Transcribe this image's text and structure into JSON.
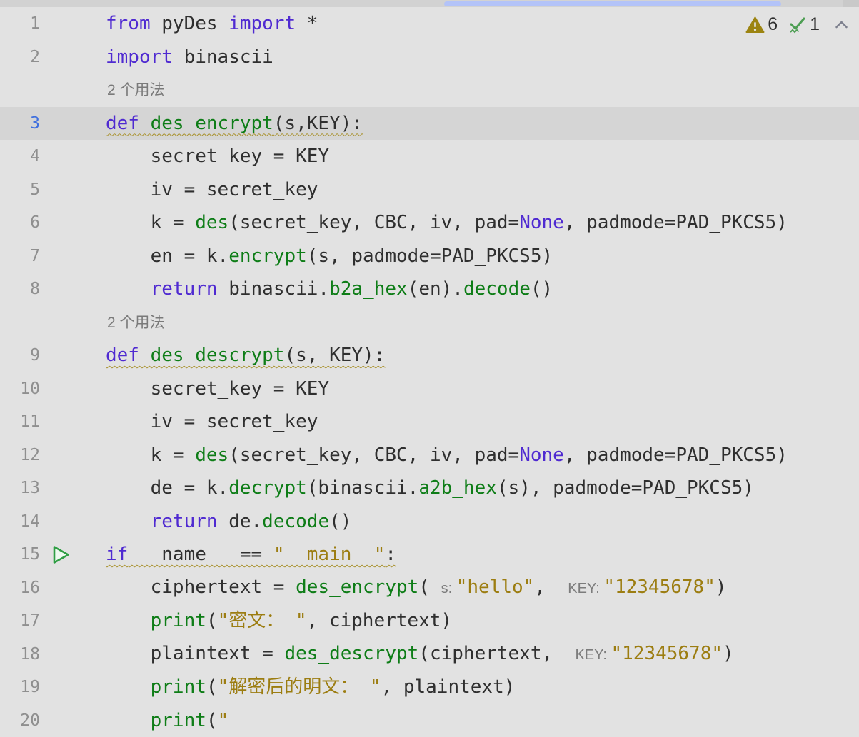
{
  "colors": {
    "editor_bg": "#e2e2e2",
    "current_line_bg": "#d5d5d5",
    "gutter_separator": "#c6c6c6",
    "keyword": "#4f2ad1",
    "function": "#0e7d17",
    "string": "#9c7d11",
    "plain_text": "#2f2f2f",
    "hint_gray": "#7c7c7c",
    "line_number": "#8f8f8f",
    "active_line_number": "#3f6fde",
    "wavy_underline": "#a8912c",
    "warning_icon": "#9c8411",
    "check_icon": "#4d9e53",
    "run_icon": "#2f9e44",
    "scrollbar_thumb": "#b3c3f8"
  },
  "topbar": {
    "scrollbar_thumb_color": "#b3c3f8"
  },
  "inspections": {
    "warning_count": "6",
    "ok_count": "1"
  },
  "editor": {
    "rows": [
      {
        "type": "code",
        "num": "1",
        "segments": [
          {
            "t": "from",
            "c": "kw"
          },
          {
            "t": " pyDes ",
            "c": "pl"
          },
          {
            "t": "import",
            "c": "kw"
          },
          {
            "t": " *",
            "c": "pl"
          }
        ]
      },
      {
        "type": "code",
        "num": "2",
        "segments": [
          {
            "t": "import",
            "c": "kw"
          },
          {
            "t": " binascii",
            "c": "pl"
          }
        ]
      },
      {
        "type": "inlay",
        "text": "2 个用法"
      },
      {
        "type": "code",
        "num": "3",
        "current": true,
        "wavy": true,
        "segments": [
          {
            "t": "def ",
            "c": "kw"
          },
          {
            "t": "des_encrypt",
            "c": "fn"
          },
          {
            "t": "(s,KEY):",
            "c": "pl"
          }
        ]
      },
      {
        "type": "code",
        "num": "4",
        "segments": [
          {
            "t": "    secret_key = KEY",
            "c": "pl"
          }
        ]
      },
      {
        "type": "code",
        "num": "5",
        "segments": [
          {
            "t": "    iv = secret_key",
            "c": "pl"
          }
        ]
      },
      {
        "type": "code",
        "num": "6",
        "segments": [
          {
            "t": "    k = ",
            "c": "pl"
          },
          {
            "t": "des",
            "c": "fn"
          },
          {
            "t": "(secret_key, CBC, iv, pad=",
            "c": "pl"
          },
          {
            "t": "None",
            "c": "kw"
          },
          {
            "t": ", padmode=PAD_PKCS5)",
            "c": "pl"
          }
        ]
      },
      {
        "type": "code",
        "num": "7",
        "segments": [
          {
            "t": "    en = k.",
            "c": "pl"
          },
          {
            "t": "encrypt",
            "c": "fn"
          },
          {
            "t": "(s, padmode=PAD_PKCS5)",
            "c": "pl"
          }
        ]
      },
      {
        "type": "code",
        "num": "8",
        "segments": [
          {
            "t": "    ",
            "c": "pl"
          },
          {
            "t": "return",
            "c": "kw"
          },
          {
            "t": " binascii.",
            "c": "pl"
          },
          {
            "t": "b2a_hex",
            "c": "fn"
          },
          {
            "t": "(en).",
            "c": "pl"
          },
          {
            "t": "decode",
            "c": "fn"
          },
          {
            "t": "()",
            "c": "pl"
          }
        ]
      },
      {
        "type": "inlay",
        "text": "2 个用法"
      },
      {
        "type": "code",
        "num": "9",
        "wavy": true,
        "segments": [
          {
            "t": "def ",
            "c": "kw"
          },
          {
            "t": "des_descrypt",
            "c": "fn"
          },
          {
            "t": "(s, KEY):",
            "c": "pl"
          }
        ]
      },
      {
        "type": "code",
        "num": "10",
        "segments": [
          {
            "t": "    secret_key = KEY",
            "c": "pl"
          }
        ]
      },
      {
        "type": "code",
        "num": "11",
        "segments": [
          {
            "t": "    iv = secret_key",
            "c": "pl"
          }
        ]
      },
      {
        "type": "code",
        "num": "12",
        "segments": [
          {
            "t": "    k = ",
            "c": "pl"
          },
          {
            "t": "des",
            "c": "fn"
          },
          {
            "t": "(secret_key, CBC, iv, pad=",
            "c": "pl"
          },
          {
            "t": "None",
            "c": "kw"
          },
          {
            "t": ", padmode=PAD_PKCS5)",
            "c": "pl"
          }
        ]
      },
      {
        "type": "code",
        "num": "13",
        "segments": [
          {
            "t": "    de = k.",
            "c": "pl"
          },
          {
            "t": "decrypt",
            "c": "fn"
          },
          {
            "t": "(binascii.",
            "c": "pl"
          },
          {
            "t": "a2b_hex",
            "c": "fn"
          },
          {
            "t": "(s), padmode=PAD_PKCS5)",
            "c": "pl"
          }
        ]
      },
      {
        "type": "code",
        "num": "14",
        "segments": [
          {
            "t": "    ",
            "c": "pl"
          },
          {
            "t": "return",
            "c": "kw"
          },
          {
            "t": " de.",
            "c": "pl"
          },
          {
            "t": "decode",
            "c": "fn"
          },
          {
            "t": "()",
            "c": "pl"
          }
        ]
      },
      {
        "type": "code",
        "num": "15",
        "run": true,
        "wavy": true,
        "segments": [
          {
            "t": "if",
            "c": "kw"
          },
          {
            "t": " __name__ == ",
            "c": "pl"
          },
          {
            "t": "\"__main__\"",
            "c": "str"
          },
          {
            "t": ":",
            "c": "pl"
          }
        ]
      },
      {
        "type": "code",
        "num": "16",
        "segments": [
          {
            "t": "    ciphertext = ",
            "c": "pl"
          },
          {
            "t": "des_encrypt",
            "c": "fn"
          },
          {
            "t": "( ",
            "c": "pl"
          },
          {
            "t": "s: ",
            "c": "hint"
          },
          {
            "t": "\"hello\"",
            "c": "str"
          },
          {
            "t": ",  ",
            "c": "pl"
          },
          {
            "t": "KEY: ",
            "c": "hint"
          },
          {
            "t": "\"12345678\"",
            "c": "str"
          },
          {
            "t": ")",
            "c": "pl"
          }
        ]
      },
      {
        "type": "code",
        "num": "17",
        "segments": [
          {
            "t": "    ",
            "c": "pl"
          },
          {
            "t": "print",
            "c": "fn"
          },
          {
            "t": "(",
            "c": "pl"
          },
          {
            "t": "\"密文： \"",
            "c": "str"
          },
          {
            "t": ", ciphertext)",
            "c": "pl"
          }
        ]
      },
      {
        "type": "code",
        "num": "18",
        "segments": [
          {
            "t": "    plaintext = ",
            "c": "pl"
          },
          {
            "t": "des_descrypt",
            "c": "fn"
          },
          {
            "t": "(ciphertext,  ",
            "c": "pl"
          },
          {
            "t": "KEY: ",
            "c": "hint"
          },
          {
            "t": "\"12345678\"",
            "c": "str"
          },
          {
            "t": ")",
            "c": "pl"
          }
        ]
      },
      {
        "type": "code",
        "num": "19",
        "segments": [
          {
            "t": "    ",
            "c": "pl"
          },
          {
            "t": "print",
            "c": "fn"
          },
          {
            "t": "(",
            "c": "pl"
          },
          {
            "t": "\"解密后的明文： \"",
            "c": "str"
          },
          {
            "t": ", plaintext)",
            "c": "pl"
          }
        ]
      },
      {
        "type": "code",
        "num": "20",
        "segments": [
          {
            "t": "    ",
            "c": "pl"
          },
          {
            "t": "print",
            "c": "fn"
          },
          {
            "t": "(",
            "c": "pl"
          },
          {
            "t": "\"",
            "c": "str"
          }
        ]
      }
    ]
  }
}
